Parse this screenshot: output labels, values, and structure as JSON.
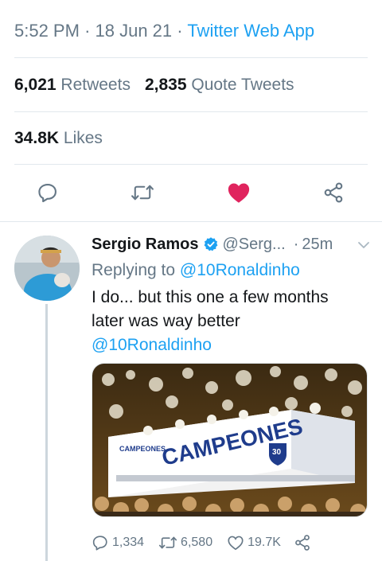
{
  "tweet": {
    "time": "5:52 PM",
    "sep1": "·",
    "date": "18 Jun 21",
    "sep2": "·",
    "source": "Twitter Web App",
    "retweets_count": "6,021",
    "retweets_label": "Retweets",
    "quotes_count": "2,835",
    "quotes_label": "Quote Tweets",
    "likes_count": "34.8K",
    "likes_label": "Likes",
    "liked": true,
    "actions": [
      "reply-icon",
      "retweet-icon",
      "heart-filled-icon",
      "share-icon"
    ]
  },
  "reply": {
    "name": "Sergio Ramos",
    "verified": true,
    "handle": "@Serg...",
    "dot": "·",
    "time": "25m",
    "replying_label": "Replying to",
    "replying_to": "@10Ronaldinho",
    "text": "I do... but this one a few months later was way better",
    "mention": "@10Ronaldinho",
    "media": {
      "banner_text": "CAMPEONES",
      "banner_small": "CAMPEONES",
      "badge": "30"
    },
    "reply_count": "1,334",
    "retweet_count": "6,580",
    "like_count": "19.7K"
  },
  "colors": {
    "accent": "#1da1f2",
    "like": "#e0245e",
    "muted": "#657786",
    "divider": "#e1e8ed"
  }
}
